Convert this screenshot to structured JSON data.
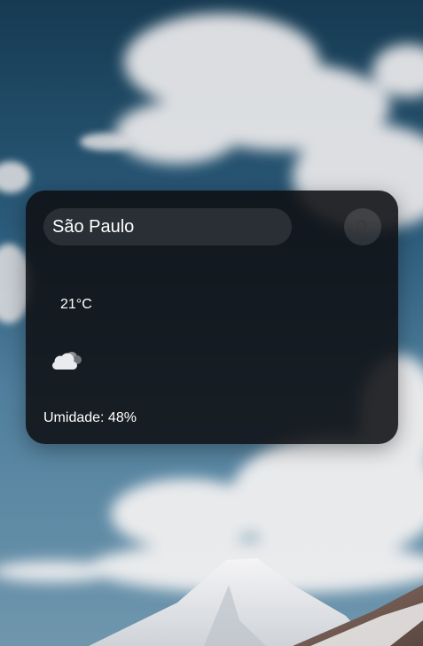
{
  "search": {
    "value": "São Paulo",
    "icon": "search-icon"
  },
  "weather": {
    "temperature": "21°C",
    "icon": "cloud-icon",
    "humidity": "Umidade: 48%"
  },
  "colors": {
    "card_background": "#0e0f12",
    "text": "#ffffff",
    "sky": "#1f4a66",
    "cloud": "#e8e8ea"
  }
}
